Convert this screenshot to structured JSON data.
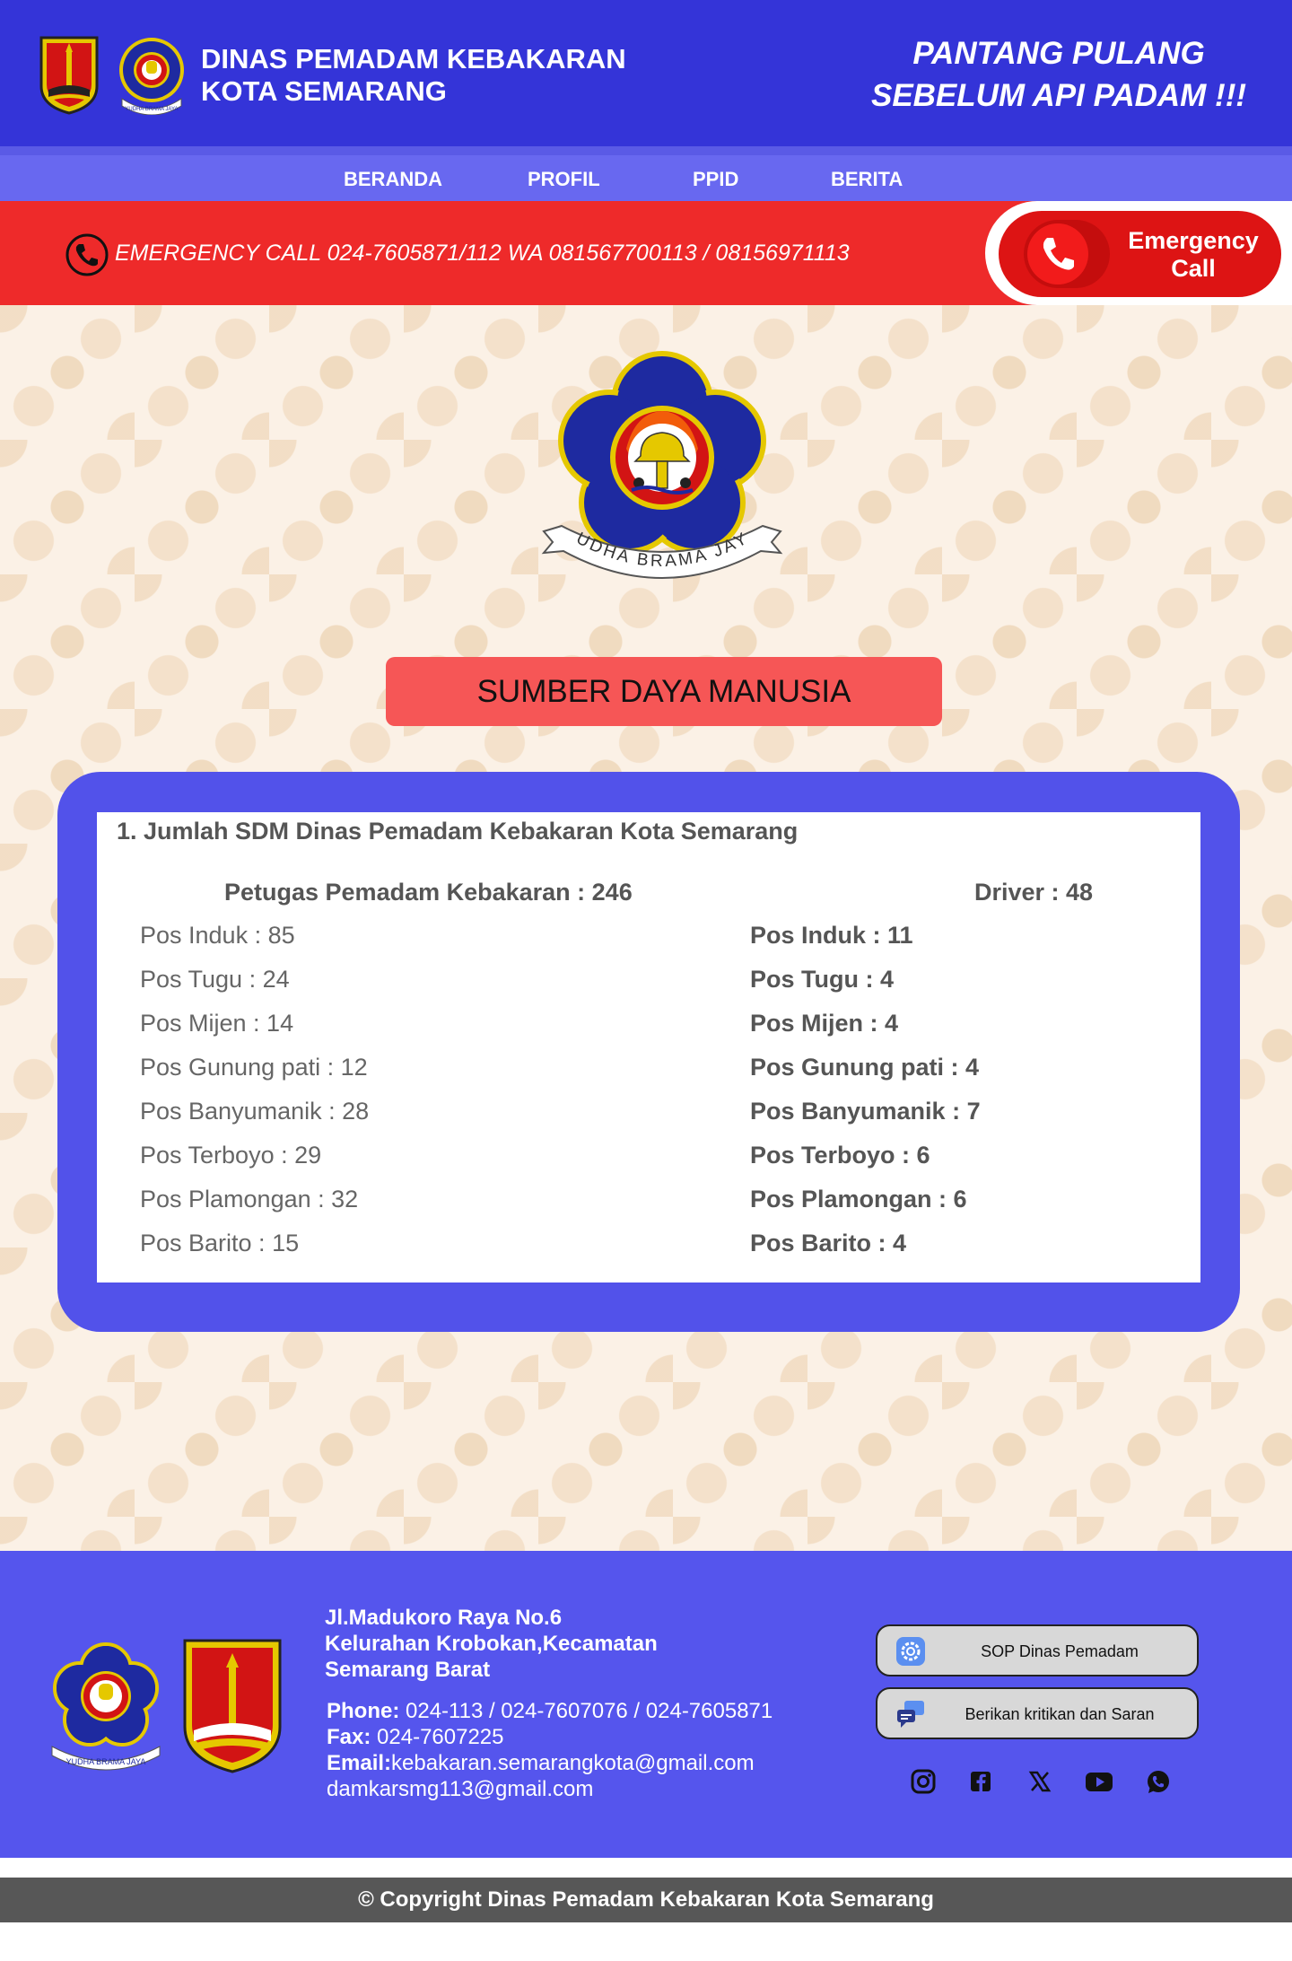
{
  "header": {
    "title_line1": "DINAS PEMADAM KEBAKARAN",
    "title_line2": "KOTA SEMARANG",
    "slogan_line1": "PANTANG PULANG",
    "slogan_line2": "SEBELUM API PADAM !!!",
    "emblem_motto": "YUDHA BRAMA JAYA"
  },
  "nav": {
    "items": [
      {
        "label": "BERANDA"
      },
      {
        "label": "PROFIL"
      },
      {
        "label": "PPID"
      },
      {
        "label": "BERITA"
      }
    ]
  },
  "emergency": {
    "text": "EMERGENCY CALL 024-7605871/112 WA 081567700113 / 08156971113",
    "button_line1": "Emergency",
    "button_line2": "Call"
  },
  "main": {
    "emblem_motto": "YUDHA BRAMA JAYA",
    "section_title": "SUMBER DAYA MANUSIA",
    "panel": {
      "heading": "1. Jumlah SDM Dinas Pemadam Kebakaran Kota Semarang",
      "left_header": "Petugas Pemadam Kebakaran  : 246",
      "right_header": "Driver : 48",
      "left_rows": [
        "Pos Induk : 85",
        "Pos Tugu : 24",
        "Pos Mijen : 14",
        "Pos Gunung  pati : 12",
        "Pos Banyumanik : 28",
        "Pos Terboyo : 29",
        "Pos Plamongan : 32",
        "Pos Barito : 15"
      ],
      "right_rows": [
        "Pos Induk : 11",
        "Pos Tugu : 4",
        "Pos Mijen : 4",
        "Pos Gunung  pati : 4",
        "Pos Banyumanik : 7",
        "Pos Terboyo : 6",
        "Pos Plamongan : 6",
        "Pos Barito : 4"
      ]
    }
  },
  "footer": {
    "address_line1": "Jl.Madukoro Raya No.6",
    "address_line2": "Kelurahan Krobokan,Kecamatan",
    "address_line3": "Semarang Barat",
    "phone_label": "Phone:",
    "phone_value": " 024-113 / 024-7607076 / 024-7605871",
    "fax_label": "Fax:",
    "fax_value": " 024-7607225",
    "email_label": "Email:",
    "email_value": "kebakaran.semarangkota@gmail.com",
    "email_value2": "damkarsmg113@gmail.com",
    "sop_button": "SOP Dinas Pemadam",
    "feedback_button": "Berikan kritikan dan Saran",
    "logo_motto": "YUDHA BRAMA JAYA",
    "social_icons": [
      "instagram-icon",
      "facebook-icon",
      "x-icon",
      "youtube-icon",
      "whatsapp-icon"
    ]
  },
  "copyright": "© Copyright Dinas Pemadam Kebakaran Kota Semarang",
  "colors": {
    "header_bg": "#3434d8",
    "nav_bg": "#6868f0",
    "emergency_bg": "#ee2a2a",
    "section_title_bg": "#f65656",
    "panel_bg": "#5252ea",
    "footer_bg": "#5555ed",
    "copyright_bg": "#575757"
  }
}
